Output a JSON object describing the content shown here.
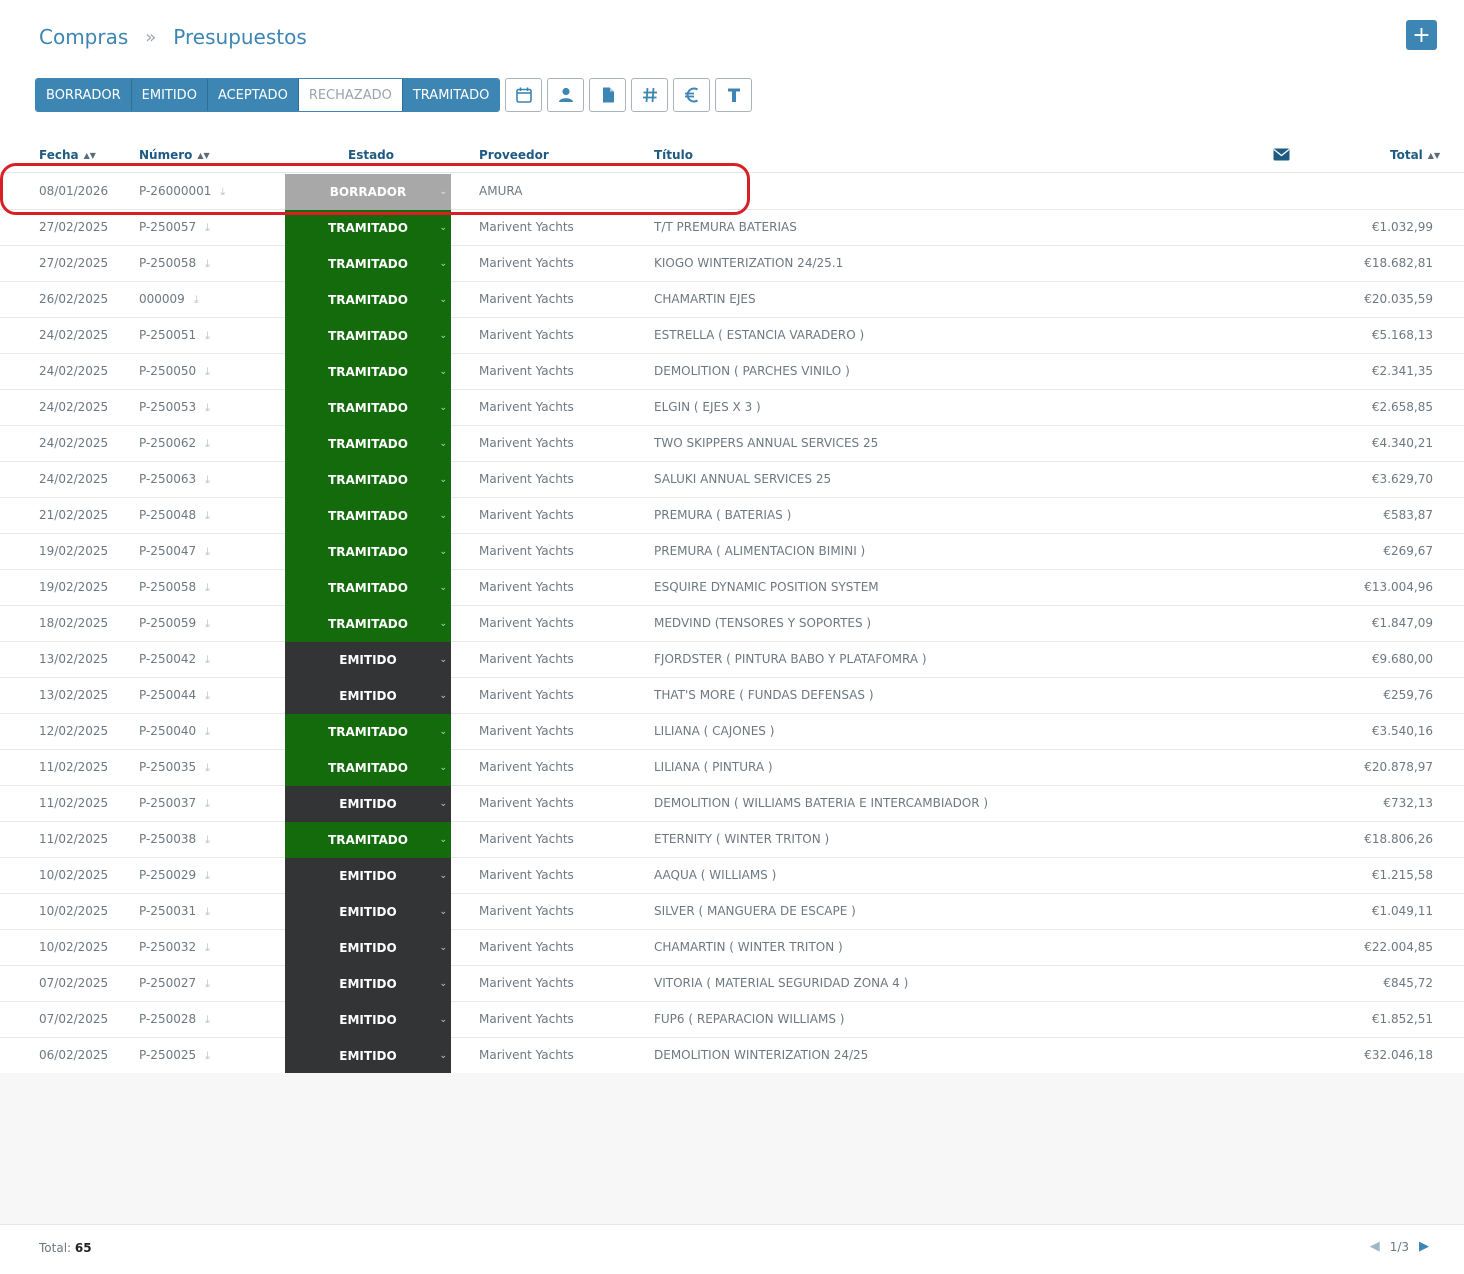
{
  "breadcrumb": {
    "section": "Compras",
    "separator": "»",
    "page": "Presupuestos"
  },
  "add_button": {
    "label": "+"
  },
  "filters": [
    {
      "label": "BORRADOR",
      "active": true
    },
    {
      "label": "EMITIDO",
      "active": true
    },
    {
      "label": "ACEPTADO",
      "active": true
    },
    {
      "label": "RECHAZADO",
      "active": false
    },
    {
      "label": "TRAMITADO",
      "active": true
    }
  ],
  "toolbar_icons": [
    "calendar-icon",
    "user-icon",
    "document-icon",
    "hash-icon",
    "euro-icon",
    "text-icon"
  ],
  "columns": {
    "fecha": "Fecha",
    "numero": "Número",
    "estado": "Estado",
    "proveedor": "Proveedor",
    "titulo": "Título",
    "email": "envelope-icon",
    "total": "Total"
  },
  "rows": [
    {
      "fecha": "08/01/2026",
      "numero": "P-26000001",
      "estado": "BORRADOR",
      "proveedor": "AMURA",
      "titulo": "",
      "total": ""
    },
    {
      "fecha": "27/02/2025",
      "numero": "P-250057",
      "estado": "TRAMITADO",
      "proveedor": "Marivent Yachts",
      "titulo": "T/T PREMURA BATERIAS",
      "total": "€1.032,99"
    },
    {
      "fecha": "27/02/2025",
      "numero": "P-250058",
      "estado": "TRAMITADO",
      "proveedor": "Marivent Yachts",
      "titulo": "KIOGO WINTERIZATION 24/25.1",
      "total": "€18.682,81"
    },
    {
      "fecha": "26/02/2025",
      "numero": "000009",
      "estado": "TRAMITADO",
      "proveedor": "Marivent Yachts",
      "titulo": "CHAMARTIN EJES",
      "total": "€20.035,59"
    },
    {
      "fecha": "24/02/2025",
      "numero": "P-250051",
      "estado": "TRAMITADO",
      "proveedor": "Marivent Yachts",
      "titulo": "ESTRELLA ( ESTANCIA VARADERO )",
      "total": "€5.168,13"
    },
    {
      "fecha": "24/02/2025",
      "numero": "P-250050",
      "estado": "TRAMITADO",
      "proveedor": "Marivent Yachts",
      "titulo": "DEMOLITION ( PARCHES VINILO )",
      "total": "€2.341,35"
    },
    {
      "fecha": "24/02/2025",
      "numero": "P-250053",
      "estado": "TRAMITADO",
      "proveedor": "Marivent Yachts",
      "titulo": "ELGIN ( EJES X 3 )",
      "total": "€2.658,85"
    },
    {
      "fecha": "24/02/2025",
      "numero": "P-250062",
      "estado": "TRAMITADO",
      "proveedor": "Marivent Yachts",
      "titulo": "TWO SKIPPERS ANNUAL SERVICES 25",
      "total": "€4.340,21"
    },
    {
      "fecha": "24/02/2025",
      "numero": "P-250063",
      "estado": "TRAMITADO",
      "proveedor": "Marivent Yachts",
      "titulo": "SALUKI ANNUAL SERVICES 25",
      "total": "€3.629,70"
    },
    {
      "fecha": "21/02/2025",
      "numero": "P-250048",
      "estado": "TRAMITADO",
      "proveedor": "Marivent Yachts",
      "titulo": "PREMURA ( BATERIAS )",
      "total": "€583,87"
    },
    {
      "fecha": "19/02/2025",
      "numero": "P-250047",
      "estado": "TRAMITADO",
      "proveedor": "Marivent Yachts",
      "titulo": "PREMURA ( ALIMENTACION BIMINI )",
      "total": "€269,67"
    },
    {
      "fecha": "19/02/2025",
      "numero": "P-250058",
      "estado": "TRAMITADO",
      "proveedor": "Marivent Yachts",
      "titulo": "ESQUIRE DYNAMIC POSITION SYSTEM",
      "total": "€13.004,96"
    },
    {
      "fecha": "18/02/2025",
      "numero": "P-250059",
      "estado": "TRAMITADO",
      "proveedor": "Marivent Yachts",
      "titulo": "MEDVIND (TENSORES Y SOPORTES )",
      "total": "€1.847,09"
    },
    {
      "fecha": "13/02/2025",
      "numero": "P-250042",
      "estado": "EMITIDO",
      "proveedor": "Marivent Yachts",
      "titulo": "FJORDSTER ( PINTURA BABO Y PLATAFOMRA )",
      "total": "€9.680,00"
    },
    {
      "fecha": "13/02/2025",
      "numero": "P-250044",
      "estado": "EMITIDO",
      "proveedor": "Marivent Yachts",
      "titulo": "THAT'S MORE ( FUNDAS DEFENSAS )",
      "total": "€259,76"
    },
    {
      "fecha": "12/02/2025",
      "numero": "P-250040",
      "estado": "TRAMITADO",
      "proveedor": "Marivent Yachts",
      "titulo": "LILIANA ( CAJONES )",
      "total": "€3.540,16"
    },
    {
      "fecha": "11/02/2025",
      "numero": "P-250035",
      "estado": "TRAMITADO",
      "proveedor": "Marivent Yachts",
      "titulo": "LILIANA ( PINTURA )",
      "total": "€20.878,97"
    },
    {
      "fecha": "11/02/2025",
      "numero": "P-250037",
      "estado": "EMITIDO",
      "proveedor": "Marivent Yachts",
      "titulo": "DEMOLITION ( WILLIAMS BATERIA E INTERCAMBIADOR )",
      "total": "€732,13"
    },
    {
      "fecha": "11/02/2025",
      "numero": "P-250038",
      "estado": "TRAMITADO",
      "proveedor": "Marivent Yachts",
      "titulo": "ETERNITY ( WINTER TRITON )",
      "total": "€18.806,26"
    },
    {
      "fecha": "10/02/2025",
      "numero": "P-250029",
      "estado": "EMITIDO",
      "proveedor": "Marivent Yachts",
      "titulo": "AAQUA ( WILLIAMS )",
      "total": "€1.215,58"
    },
    {
      "fecha": "10/02/2025",
      "numero": "P-250031",
      "estado": "EMITIDO",
      "proveedor": "Marivent Yachts",
      "titulo": "SILVER ( MANGUERA DE ESCAPE )",
      "total": "€1.049,11"
    },
    {
      "fecha": "10/02/2025",
      "numero": "P-250032",
      "estado": "EMITIDO",
      "proveedor": "Marivent Yachts",
      "titulo": "CHAMARTIN ( WINTER TRITON )",
      "total": "€22.004,85"
    },
    {
      "fecha": "07/02/2025",
      "numero": "P-250027",
      "estado": "EMITIDO",
      "proveedor": "Marivent Yachts",
      "titulo": "VITORIA ( MATERIAL SEGURIDAD ZONA 4 )",
      "total": "€845,72"
    },
    {
      "fecha": "07/02/2025",
      "numero": "P-250028",
      "estado": "EMITIDO",
      "proveedor": "Marivent Yachts",
      "titulo": "FUP6 ( REPARACION WILLIAMS )",
      "total": "€1.852,51"
    },
    {
      "fecha": "06/02/2025",
      "numero": "P-250025",
      "estado": "EMITIDO",
      "proveedor": "Marivent Yachts",
      "titulo": "DEMOLITION WINTERIZATION 24/25",
      "total": "€32.046,18"
    }
  ],
  "footer": {
    "total_label": "Total:",
    "total_count": "65",
    "page": "1/3"
  },
  "colors": {
    "accent": "#3d86b4",
    "tramitado": "#136b0c",
    "emitido": "#333436",
    "borrador": "#a8a8a8",
    "highlight": "#d91f26"
  }
}
